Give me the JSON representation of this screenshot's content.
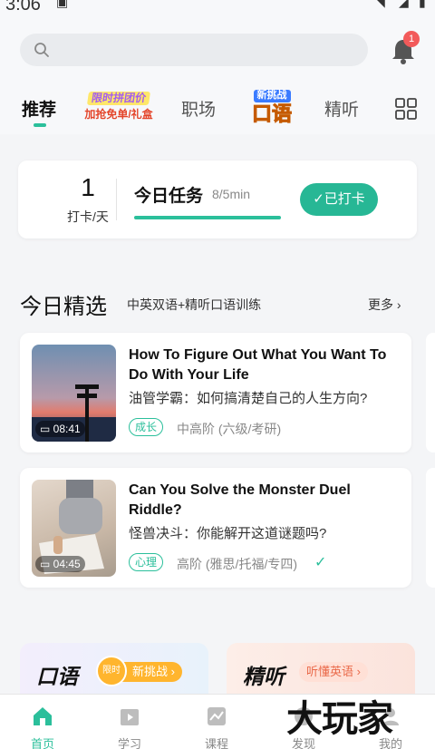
{
  "statusbar": {
    "time": "3:06"
  },
  "header": {
    "notification_count": "1"
  },
  "tabs": {
    "items": [
      "推荐",
      "职场",
      "精听"
    ],
    "promo1_line1": "限时拼团价",
    "promo1_line2": "加抢免单/礼盒",
    "promo2_line1": "新挑战",
    "promo2_line2": "口语"
  },
  "checkin": {
    "streak_days": "1",
    "streak_label": "打卡/天",
    "task_title": "今日任务",
    "task_progress": "8/5min",
    "checked_label": "✓已打卡"
  },
  "section": {
    "title": "今日精选",
    "subtitle": "中英双语+精听口语训练",
    "more": "更多 ›"
  },
  "videos": [
    {
      "duration": "08:41",
      "title_en": "How To Figure Out What You Want To Do With Your Life",
      "title_zh": "油管学霸：如何搞清楚自己的人生方向?",
      "tag": "成长",
      "level": "中高阶 (六级/考研)"
    },
    {
      "duration": "04:45",
      "title_en": "Can You Solve the Monster Duel Riddle?",
      "title_zh": "怪兽决斗：你能解开这道谜题吗?",
      "tag": "心理",
      "level": "高阶 (雅思/托福/专四)"
    }
  ],
  "promo_cards": {
    "oral_title": "口语",
    "oral_clock": "限时",
    "oral_pill": "新挑战 ›",
    "listen_title": "精听",
    "listen_pill": "听懂英语 ›"
  },
  "bottom_nav": {
    "items": [
      "首页",
      "学习",
      "课程",
      "发现",
      "我的"
    ],
    "active_color": "#2bbf9b"
  },
  "watermark": "大玩家"
}
